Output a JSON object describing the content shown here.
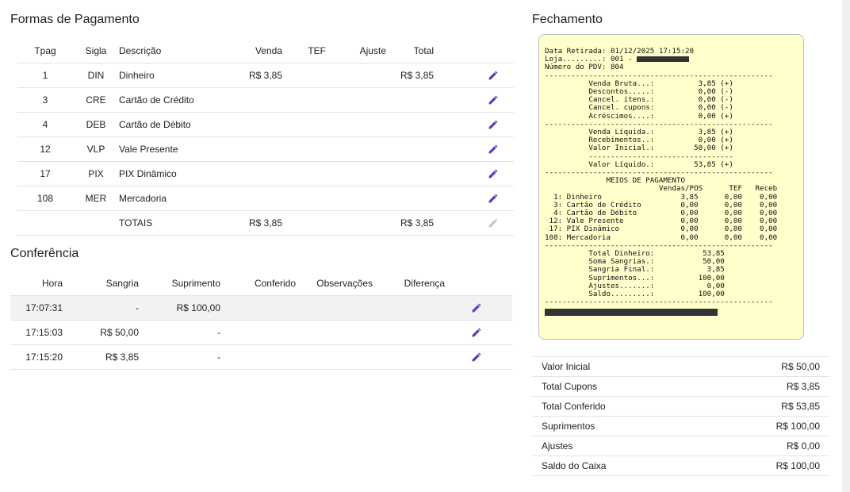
{
  "formas": {
    "title": "Formas de Pagamento",
    "headers": {
      "tpag": "Tpag",
      "sigla": "Sigla",
      "descricao": "Descrição",
      "venda": "Venda",
      "tef": "TEF",
      "ajuste": "Ajuste",
      "total": "Total"
    },
    "rows": [
      {
        "tpag": "1",
        "sigla": "DIN",
        "descricao": "Dinheiro",
        "venda": "R$ 3,85",
        "tef": "",
        "ajuste": "",
        "total": "R$ 3,85"
      },
      {
        "tpag": "3",
        "sigla": "CRE",
        "descricao": "Cartão de Crédito",
        "venda": "",
        "tef": "",
        "ajuste": "",
        "total": ""
      },
      {
        "tpag": "4",
        "sigla": "DEB",
        "descricao": "Cartão de Débito",
        "venda": "",
        "tef": "",
        "ajuste": "",
        "total": ""
      },
      {
        "tpag": "12",
        "sigla": "VLP",
        "descricao": "Vale Presente",
        "venda": "",
        "tef": "",
        "ajuste": "",
        "total": ""
      },
      {
        "tpag": "17",
        "sigla": "PIX",
        "descricao": "PIX Dinâmico",
        "venda": "",
        "tef": "",
        "ajuste": "",
        "total": ""
      },
      {
        "tpag": "108",
        "sigla": "MER",
        "descricao": "Mercadoria",
        "venda": "",
        "tef": "",
        "ajuste": "",
        "total": ""
      }
    ],
    "totals": {
      "label": "TOTAIS",
      "venda": "R$ 3,85",
      "total": "R$ 3,85"
    }
  },
  "conferencia": {
    "title": "Conferência",
    "headers": {
      "hora": "Hora",
      "sangria": "Sangria",
      "suprimento": "Suprimento",
      "conferido": "Conferido",
      "observacoes": "Observações",
      "diferenca": "Diferença"
    },
    "rows": [
      {
        "hora": "17:07:31",
        "sangria": "-",
        "suprimento": "R$ 100,00",
        "conferido": "",
        "observacoes": "",
        "diferenca": ""
      },
      {
        "hora": "17:15:03",
        "sangria": "R$ 50,00",
        "suprimento": "-",
        "conferido": "",
        "observacoes": "",
        "diferenca": ""
      },
      {
        "hora": "17:15:20",
        "sangria": "R$ 3,85",
        "suprimento": "-",
        "conferido": "",
        "observacoes": "",
        "diferenca": ""
      }
    ]
  },
  "fechamento": {
    "title": "Fechamento",
    "receipt": {
      "header_lines": [
        "Data Retirada: 01/12/2025 17:15:20",
        "Loja.........: 001 - ",
        "Número do PDV: 804"
      ],
      "body_lines": [
        "----------------------------------------------------",
        "          Venda Bruta...:          3,85 (+)",
        "          Descontos.....:          0,00 (-)",
        "          Cancel. itens.:          0,00 (-)",
        "          Cancel. cupons:          0,00 (-)",
        "          Acréscimos....:          0,00 (+)",
        "----------------------------------------------------",
        "          Venda Líquida.:          3,85 (+)",
        "          Recebimentos..:          0,00 (+)",
        "          Valor Inicial.:         50,00 (+)",
        "          ---------------------------------",
        "          Valor Líquido.:         53,85 (+)",
        "----------------------------------------------------",
        "              MEIOS DE PAGAMENTO",
        "                          Vendas/POS      TEF   Receb",
        "  1: Dinheiro                  3,85      0,00    0,00",
        "  3: Cartão de Crédito         0,00      0,00    0,00",
        "  4: Cartão de Débito          0,00      0,00    0,00",
        " 12: Vale Presente             0,00      0,00    0,00",
        " 17: PIX Dinâmico              0,00      0,00    0,00",
        "108: Mercadoria                0,00      0,00    0,00",
        "----------------------------------------------------",
        "          Total Dinheiro:           53,85",
        "          Soma Sangrias.:           50,00",
        "          Sangria Final.:            3,85",
        "          Suprimentos...:          100,00",
        "          Ajustes.......:            0,00",
        "          Saldo.........:          100,00",
        "----------------------------------------------------"
      ]
    },
    "summary": [
      {
        "label": "Valor Inicial",
        "value": "R$ 50,00"
      },
      {
        "label": "Total Cupons",
        "value": "R$ 3,85"
      },
      {
        "label": "Total Conferido",
        "value": "R$ 53,85"
      },
      {
        "label": "Suprimentos",
        "value": "R$ 100,00"
      },
      {
        "label": "Ajustes",
        "value": "R$ 0,00"
      },
      {
        "label": "Saldo do Caixa",
        "value": "R$ 100,00"
      }
    ]
  },
  "colors": {
    "edit_icon": "#5b3bc4",
    "edit_icon_disabled": "#c4c4c4",
    "receipt_bg": "#ffffcc"
  },
  "icons": {
    "edit": "pencil-icon"
  }
}
